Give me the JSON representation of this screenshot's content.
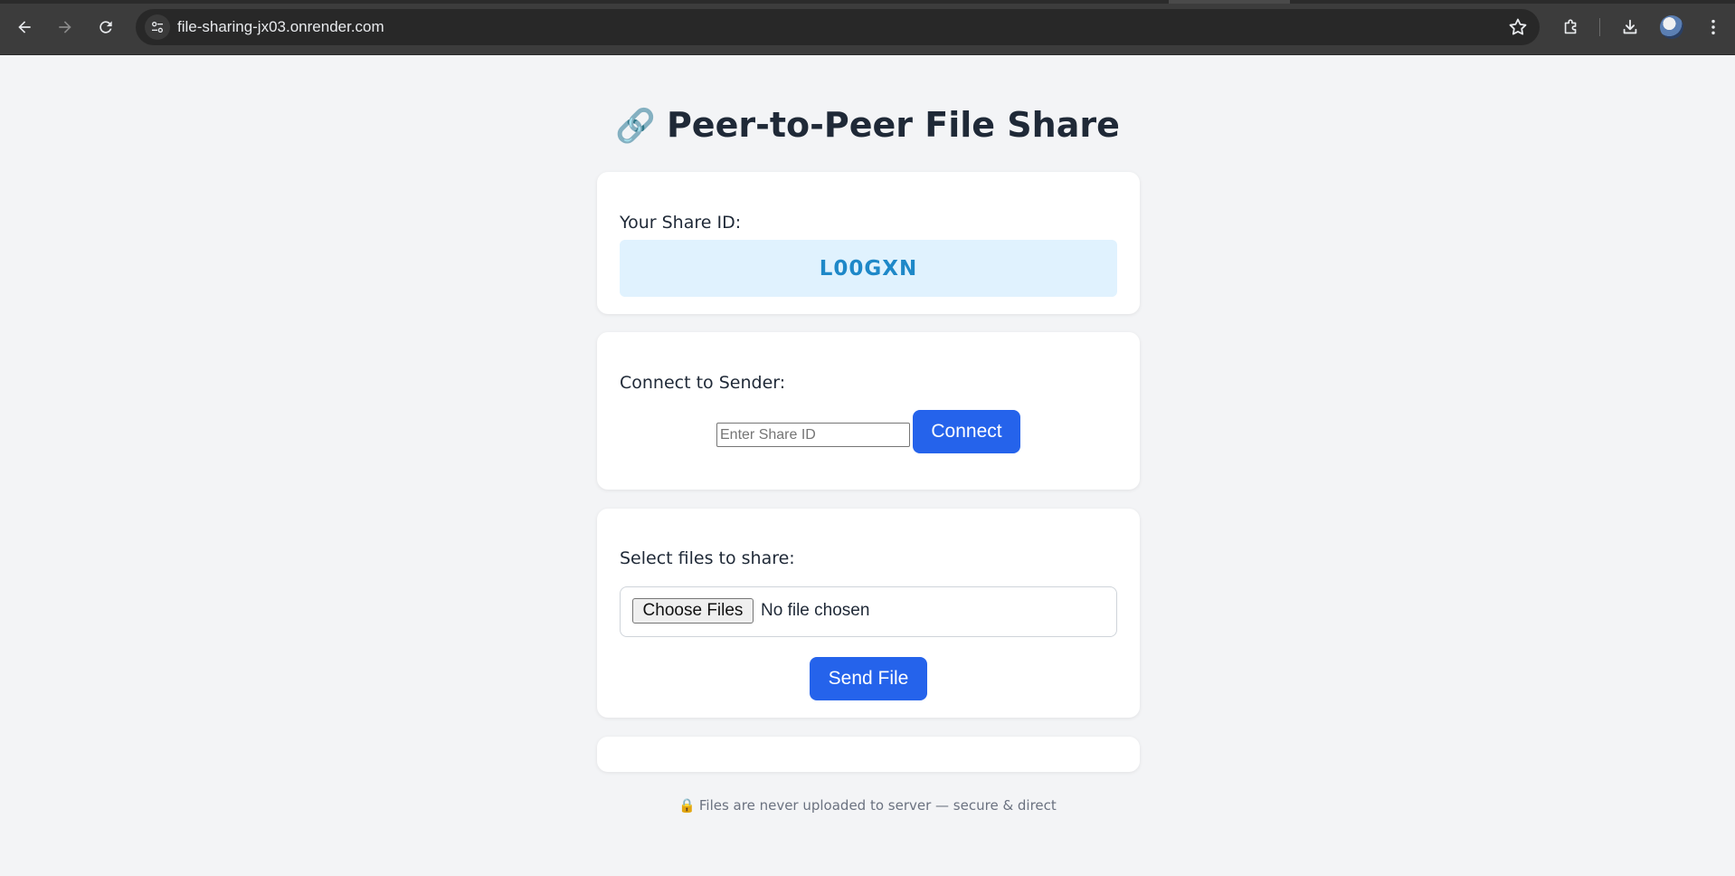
{
  "browser": {
    "url": "file-sharing-jx03.onrender.com",
    "icons": {
      "back": "back-arrow-icon",
      "forward": "forward-arrow-icon",
      "reload": "reload-icon",
      "site_info": "tune-icon",
      "bookmark": "star-icon",
      "extensions": "puzzle-icon",
      "downloads": "download-icon",
      "profile": "avatar",
      "menu": "kebab-menu-icon"
    }
  },
  "page": {
    "title_icon": "🔗",
    "title": "Peer-to-Peer File Share",
    "share_card": {
      "label": "Your Share ID:",
      "share_id": "L00GXN"
    },
    "connect_card": {
      "label": "Connect to Sender:",
      "input_value": "",
      "input_placeholder": "Enter Share ID",
      "button_label": "Connect"
    },
    "send_card": {
      "label": "Select files to share:",
      "choose_button_label": "Choose Files",
      "file_status": "No file chosen",
      "send_button_label": "Send File"
    },
    "footer": {
      "icon": "🔒",
      "text": "Files are never uploaded to server — secure & direct"
    }
  },
  "colors": {
    "accent": "#2563eb",
    "share_id_bg": "#e0f2fe",
    "share_id_text": "#1e88c8",
    "page_bg": "#f3f4f6"
  }
}
